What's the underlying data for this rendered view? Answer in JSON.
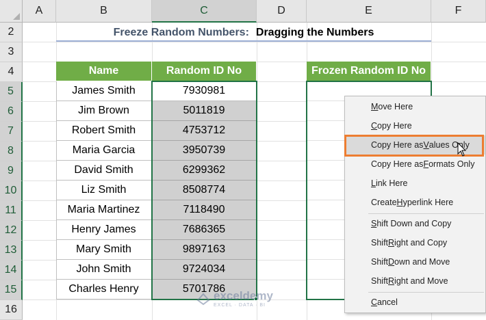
{
  "columns": [
    "A",
    "B",
    "C",
    "D",
    "E",
    "F"
  ],
  "rows": [
    "2",
    "3",
    "4",
    "5",
    "6",
    "7",
    "8",
    "9",
    "10",
    "11",
    "12",
    "13",
    "14",
    "15",
    "16"
  ],
  "title": {
    "prefix": "Freeze Random Numbers:",
    "main": "Dragging the Numbers"
  },
  "table": {
    "headers": [
      "Name",
      "Random ID No"
    ],
    "rows": [
      {
        "name": "James Smith",
        "id": "7930981"
      },
      {
        "name": "Jim Brown",
        "id": "5011819"
      },
      {
        "name": "Robert Smith",
        "id": "4753712"
      },
      {
        "name": "Maria Garcia",
        "id": "3950739"
      },
      {
        "name": "David Smith",
        "id": "6299362"
      },
      {
        "name": "Liz Smith",
        "id": "8508774"
      },
      {
        "name": "Maria Martinez",
        "id": "7118490"
      },
      {
        "name": "Henry James",
        "id": "7686365"
      },
      {
        "name": "Mary Smith",
        "id": "9897163"
      },
      {
        "name": "John Smith",
        "id": "9724034"
      },
      {
        "name": "Charles Henry",
        "id": "5701786"
      }
    ]
  },
  "frozen_header": "Frozen Random ID No",
  "context_menu": [
    {
      "pre": "",
      "key": "M",
      "post": "ove Here"
    },
    {
      "pre": "",
      "key": "C",
      "post": "opy Here"
    },
    {
      "pre": "Copy Here as ",
      "key": "V",
      "post": "alues Only"
    },
    {
      "pre": "Copy Here as ",
      "key": "F",
      "post": "ormats Only"
    },
    {
      "pre": "",
      "key": "L",
      "post": "ink Here"
    },
    {
      "pre": "Create ",
      "key": "H",
      "post": "yperlink Here"
    },
    {
      "pre": "",
      "key": "S",
      "post": "hift Down and Copy"
    },
    {
      "pre": "Shift ",
      "key": "R",
      "post": "ight and Copy"
    },
    {
      "pre": "Shift ",
      "key": "D",
      "post": "own and Move"
    },
    {
      "pre": "Shift ",
      "key": "R",
      "post": "ight and Move"
    },
    {
      "pre": "",
      "key": "C",
      "post": "ancel"
    }
  ],
  "watermark": {
    "name": "exceldemy",
    "tagline": "EXCEL · DATA · BI"
  },
  "colors": {
    "header_green": "#70ad47",
    "selection_green": "#217346",
    "highlight_orange": "#ed7d31",
    "gray_fill": "#d0d0d0"
  }
}
